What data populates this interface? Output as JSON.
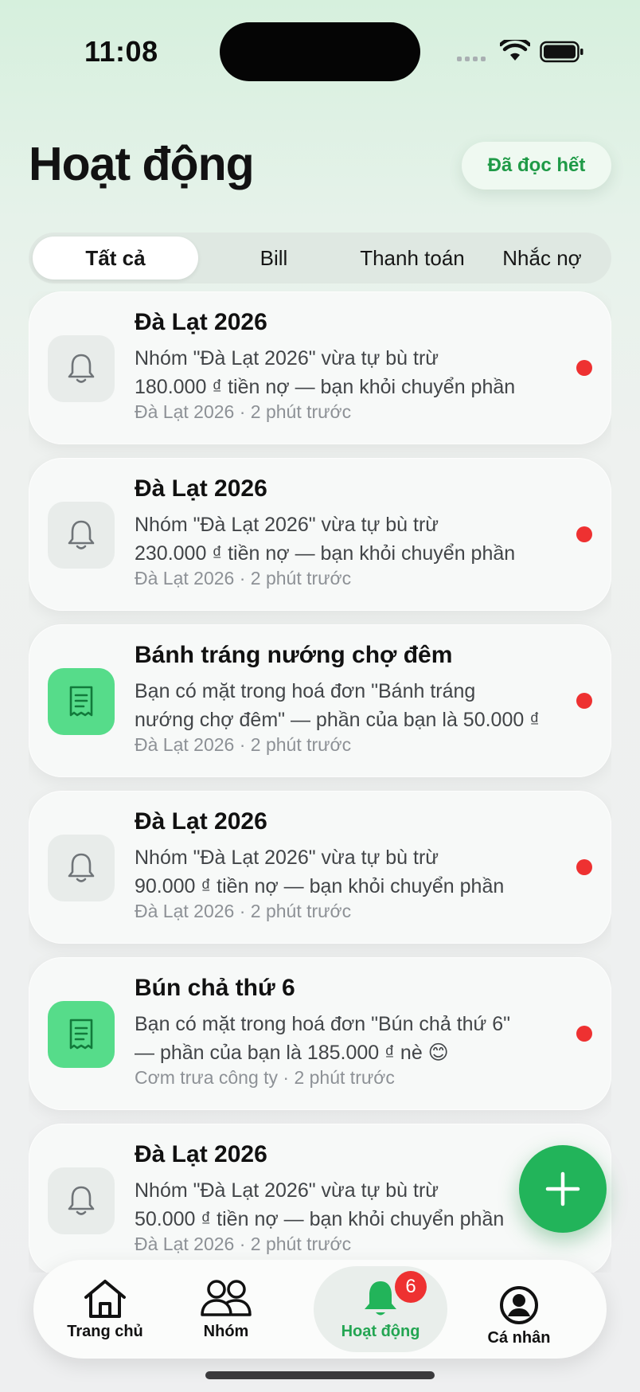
{
  "status_bar": {
    "time": "11:08"
  },
  "header": {
    "title": "Hoạt động",
    "mark_all_read_label": "Đã đọc hết"
  },
  "filters": {
    "tabs": [
      {
        "label": "Tất cả",
        "active": true
      },
      {
        "label": "Bill",
        "active": false
      },
      {
        "label": "Thanh toán",
        "active": false
      },
      {
        "label": "Nhắc nợ",
        "active": false
      }
    ]
  },
  "notifications": [
    {
      "icon": "bell-icon",
      "title": "Đà Lạt 2026",
      "line1": "Nhóm \"Đà Lạt 2026\" vừa tự bù trừ",
      "line2": "180.000 ₫ tiền nợ — bạn khỏi chuyển phần",
      "meta": "Đà Lạt 2026 · 2 phút trước",
      "unread": true
    },
    {
      "icon": "bell-icon",
      "title": "Đà Lạt 2026",
      "line1": "Nhóm \"Đà Lạt 2026\" vừa tự bù trừ",
      "line2": "230.000 ₫ tiền nợ — bạn khỏi chuyển phần",
      "meta": "Đà Lạt 2026 · 2 phút trước",
      "unread": true
    },
    {
      "icon": "receipt-icon",
      "title": "Bánh tráng nướng chợ đêm",
      "line1": "Bạn có mặt trong hoá đơn \"Bánh tráng",
      "line2": "nướng chợ đêm\" — phần của bạn là 50.000 ₫",
      "meta": "Đà Lạt 2026 · 2 phút trước",
      "unread": true
    },
    {
      "icon": "bell-icon",
      "title": "Đà Lạt 2026",
      "line1": "Nhóm \"Đà Lạt 2026\" vừa tự bù trừ",
      "line2": "90.000 ₫ tiền nợ — bạn khỏi chuyển phần",
      "meta": "Đà Lạt 2026 · 2 phút trước",
      "unread": true
    },
    {
      "icon": "receipt-icon",
      "title": "Bún chả thứ 6",
      "line1": "Bạn có mặt trong hoá đơn \"Bún chả thứ 6\"",
      "line2": "— phần của bạn là 185.000 ₫ nè 😊",
      "meta": "Cơm trưa công ty · 2 phút trước",
      "unread": true
    },
    {
      "icon": "bell-icon",
      "title": "Đà Lạt 2026",
      "line1": "Nhóm \"Đà Lạt 2026\" vừa tự bù trừ",
      "line2": "50.000 ₫ tiền nợ — bạn khỏi chuyển phần",
      "meta": "Đà Lạt 2026 · 2 phút trước",
      "unread": false
    }
  ],
  "tab_bar": {
    "items": [
      {
        "label": "Trang chủ",
        "icon": "home-icon",
        "active": false
      },
      {
        "label": "Nhóm",
        "icon": "group-icon",
        "active": false
      },
      {
        "label": "Hoạt động",
        "icon": "bell-icon",
        "active": true,
        "badge": "6"
      },
      {
        "label": "Cá nhân",
        "icon": "profile-icon",
        "active": false
      }
    ]
  },
  "colors": {
    "accent": "#22b45a",
    "unread": "#ee3131",
    "active_tab_text": "#23a552"
  }
}
